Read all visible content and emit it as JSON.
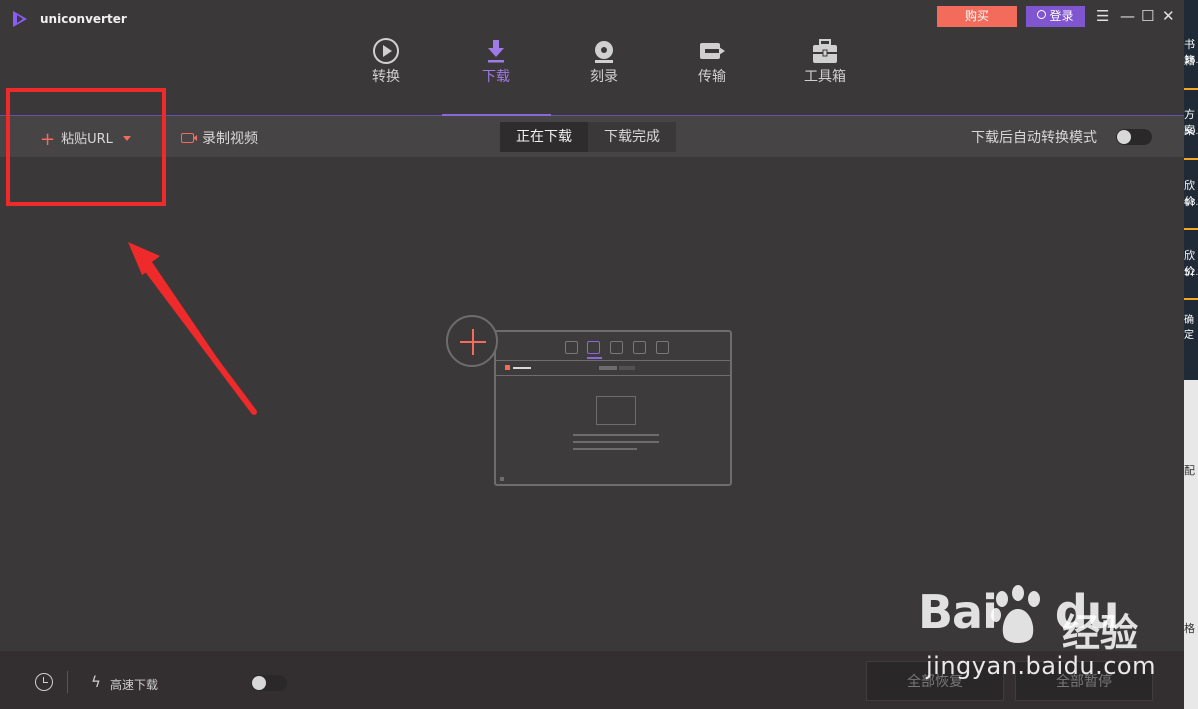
{
  "app": {
    "name": "uniconverter"
  },
  "titlebar": {
    "buy_label": "购买",
    "login_label": "登录",
    "menu_glyph": "☰",
    "min_glyph": "—",
    "max_glyph": "☐",
    "close_glyph": "✕"
  },
  "nav": {
    "items": [
      {
        "label": "转换",
        "icon": "convert-play-icon"
      },
      {
        "label": "下载",
        "icon": "download-arrow-icon",
        "active": true
      },
      {
        "label": "刻录",
        "icon": "burn-disc-icon"
      },
      {
        "label": "传输",
        "icon": "transfer-icon"
      },
      {
        "label": "工具箱",
        "icon": "toolbox-icon"
      }
    ]
  },
  "toolbar": {
    "paste_url_label": "粘贴URL",
    "record_label": "录制视频",
    "tabs": [
      "正在下载",
      "下载完成"
    ],
    "active_tab": "正在下载",
    "auto_convert_label": "下载后自动转换模式",
    "auto_convert_on": false
  },
  "bottom": {
    "fast_download_label": "高速下载",
    "fast_download_on": false,
    "resume_all_label": "全部恢复",
    "pause_all_label": "全部暂停"
  },
  "right_strip": [
    "书籍",
    "36.",
    "方案",
    "50.",
    "欣价",
    "48.",
    "欣价",
    "52.",
    "确定",
    "配",
    "格"
  ],
  "watermark": {
    "brand": "Bai",
    "brand2": "du",
    "cn": "经验",
    "url": "jingyan.baidu.com"
  },
  "colors": {
    "accent": "#8b67d8",
    "buy": "#f26b5b",
    "annotation": "#ee2a2a"
  }
}
